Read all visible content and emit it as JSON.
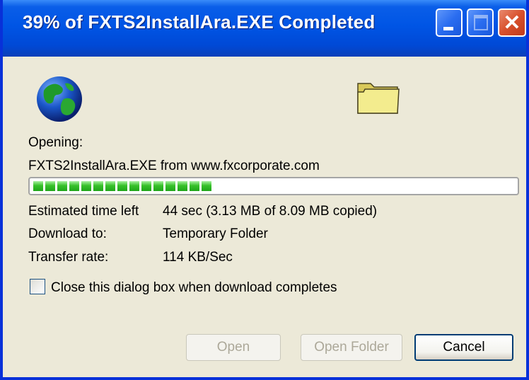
{
  "window": {
    "title": "39% of FXTS2InstallAra.EXE Completed",
    "minimize_glyph": "_",
    "close_glyph": "✕"
  },
  "status": {
    "opening_label": "Opening:",
    "file_source": "FXTS2InstallAra.EXE from www.fxcorporate.com",
    "progress_percent": 39
  },
  "details": {
    "time_left_label": "Estimated time left",
    "time_left_value": "44 sec (3.13 MB of 8.09 MB copied)",
    "download_to_label": "Download to:",
    "download_to_value": "Temporary Folder",
    "transfer_rate_label": "Transfer rate:",
    "transfer_rate_value": "114 KB/Sec"
  },
  "close_option": {
    "label": "Close this dialog box when download completes",
    "checked": false
  },
  "buttons": {
    "open": "Open",
    "open_folder": "Open Folder",
    "cancel": "Cancel"
  },
  "icons": {
    "globe": "globe-icon",
    "folder": "folder-icon"
  }
}
